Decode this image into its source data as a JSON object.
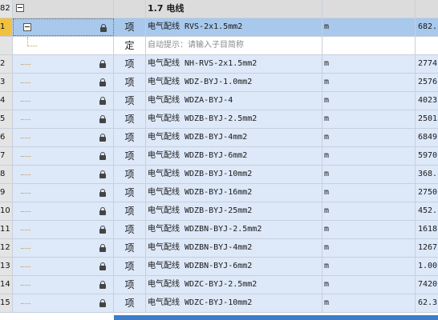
{
  "header": {
    "num": "82",
    "name": "1.7 电线"
  },
  "selected": {
    "num": "1",
    "type": "项",
    "name": "电气配线 RVS-2x1.5mm2",
    "unit": "m",
    "qty": "682."
  },
  "hint": {
    "type": "定",
    "text": "自动提示：请输入子目简称"
  },
  "rows": [
    {
      "num": "2",
      "type": "项",
      "name": "电气配线 NH-RVS-2x1.5mm2",
      "unit": "m",
      "qty": "2774"
    },
    {
      "num": "3",
      "type": "项",
      "name": "电气配线 WDZ-BYJ-1.0mm2",
      "unit": "m",
      "qty": "2576"
    },
    {
      "num": "4",
      "type": "项",
      "name": "电气配线 WDZA-BYJ-4",
      "unit": "m",
      "qty": "4023"
    },
    {
      "num": "5",
      "type": "项",
      "name": "电气配线 WDZB-BYJ-2.5mm2",
      "unit": "m",
      "qty": "2501"
    },
    {
      "num": "6",
      "type": "项",
      "name": "电气配线 WDZB-BYJ-4mm2",
      "unit": "m",
      "qty": "6849"
    },
    {
      "num": "7",
      "type": "项",
      "name": "电气配线 WDZB-BYJ-6mm2",
      "unit": "m",
      "qty": "5970"
    },
    {
      "num": "8",
      "type": "项",
      "name": "电气配线 WDZB-BYJ-10mm2",
      "unit": "m",
      "qty": "368."
    },
    {
      "num": "9",
      "type": "项",
      "name": "电气配线 WDZB-BYJ-16mm2",
      "unit": "m",
      "qty": "2750"
    },
    {
      "num": "10",
      "type": "项",
      "name": "电气配线 WDZB-BYJ-25mm2",
      "unit": "m",
      "qty": "452."
    },
    {
      "num": "11",
      "type": "项",
      "name": "电气配线 WDZBN-BYJ-2.5mm2",
      "unit": "m",
      "qty": "1618"
    },
    {
      "num": "12",
      "type": "项",
      "name": "电气配线 WDZBN-BYJ-4mm2",
      "unit": "m",
      "qty": "1267"
    },
    {
      "num": "13",
      "type": "项",
      "name": "电气配线 WDZBN-BYJ-6mm2",
      "unit": "m",
      "qty": "1.00"
    },
    {
      "num": "14",
      "type": "项",
      "name": "电气配线 WDZC-BYJ-2.5mm2",
      "unit": "m",
      "qty": "7420"
    },
    {
      "num": "15",
      "type": "项",
      "name": "电气配线 WDZC-BYJ-10mm2",
      "unit": "m",
      "qty": "62.3"
    }
  ]
}
